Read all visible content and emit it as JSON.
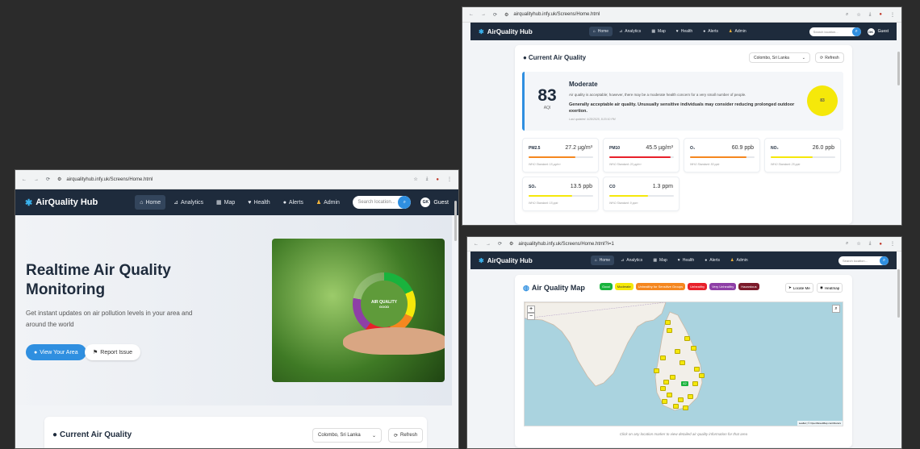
{
  "colors": {
    "nav": "#1e2b3c",
    "accent": "#2f8fe0",
    "moderate": "#f5e80a"
  },
  "browser_left": {
    "url": "airqualityhub.infy.uk/Screens/Home.html"
  },
  "browser_right_top": {
    "url": "airqualityhub.infy.uk/Screens/Home.html"
  },
  "browser_right_bottom": {
    "url": "airqualityhub.infy.uk/Screens/Home.html?i=1"
  },
  "app": {
    "brand": "AirQuality Hub",
    "nav": [
      "Home",
      "Analytics",
      "Map",
      "Health",
      "Alerts",
      "Admin"
    ],
    "search_placeholder": "Search location...",
    "user_initials": "GK",
    "user_label": "Guest"
  },
  "hero": {
    "title_line1": "Realtime Air Quality",
    "title_line2": "Monitoring",
    "subtitle": "Get instant updates on air pollution levels in your area and around the world",
    "primary_button": "View Your Area",
    "secondary_button": "Report Issue",
    "image_label_1": "AIR QUALITY",
    "image_label_2": "GOOD"
  },
  "current": {
    "title": "Current Air Quality",
    "location": "Colombo, Sri Lanka",
    "refresh": "Refresh",
    "aqi": "83",
    "aqi_label": "AQI",
    "level": "Moderate",
    "desc": "Air quality is acceptable; however, there may be a moderate health concern for a very small number of people.",
    "advice": "Generally acceptable air quality. Unusually sensitive individuals may consider reducing prolonged outdoor exertion.",
    "updated": "Last updated: 4/28/2025, 8:20:10 PM",
    "badge": "83"
  },
  "pollutants": [
    {
      "name": "PM2.5",
      "value": "27.2 µg/m³",
      "std": "WHO Standard: 15 µg/m³",
      "level": 0.72,
      "color": "#f5871f"
    },
    {
      "name": "PM10",
      "value": "45.5 µg/m³",
      "std": "WHO Standard: 20 µg/m³",
      "level": 0.95,
      "color": "#e8202a"
    },
    {
      "name": "O₃",
      "value": "60.9 ppb",
      "std": "WHO Standard: 50 ppb",
      "level": 0.88,
      "color": "#f5871f"
    },
    {
      "name": "NO₂",
      "value": "26.0 ppb",
      "std": "WHO Standard: 25 ppb",
      "level": 0.65,
      "color": "#f5e80a"
    },
    {
      "name": "SO₂",
      "value": "13.5 ppb",
      "std": "WHO Standard: 15 ppb",
      "level": 0.68,
      "color": "#f5e80a"
    },
    {
      "name": "CO",
      "value": "1.3 ppm",
      "std": "WHO Standard: 9 ppm",
      "level": 0.6,
      "color": "#f5e80a"
    }
  ],
  "map": {
    "title": "Air Quality Map",
    "legend": [
      {
        "label": "Good",
        "color": "#19b33d",
        "text": "#fff"
      },
      {
        "label": "Moderate",
        "color": "#f5e80a",
        "text": "#333"
      },
      {
        "label": "Unhealthy for Sensitive Groups",
        "color": "#f5871f",
        "text": "#fff"
      },
      {
        "label": "Unhealthy",
        "color": "#e8202a",
        "text": "#fff"
      },
      {
        "label": "Very Unhealthy",
        "color": "#8e3fa6",
        "text": "#fff"
      },
      {
        "label": "Hazardous",
        "color": "#7b1a2a",
        "text": "#fff"
      }
    ],
    "locate_me": "Locate Me",
    "heatmap": "Heatmap",
    "zoom_in": "+",
    "zoom_out": "−",
    "center_label": "42",
    "attribution": "Leaflet | © OpenStreetMap contributors",
    "caption": "Click on any location marker to view detailed air quality information for that area"
  }
}
